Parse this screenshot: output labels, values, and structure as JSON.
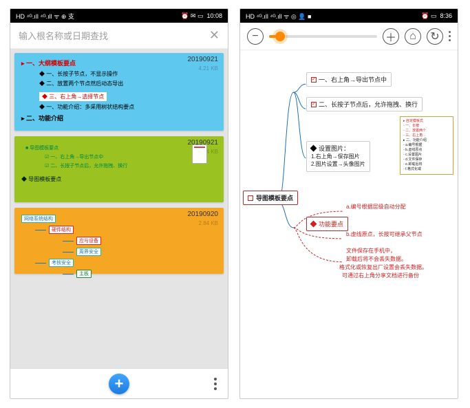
{
  "phoneL": {
    "statusbar": {
      "left": "HD ⁴ᴳ.ıll ⁴ᴳ.ıll ᯤ ⊕ 支",
      "right_icons": "⏰ ✉ ▭",
      "time": "10:08"
    },
    "search": {
      "placeholder": "输入根名称或日期查找",
      "close": "✕"
    },
    "cards": [
      {
        "bg": "#5fc8ee",
        "date": "20190921",
        "size": "4.21 KB",
        "title": "▸ 一、大纲模板要点",
        "items": [
          "◆ 一、长按子节点，不显示操作",
          "◆ 二、放置两个节点然后动态导出",
          "◆ 三、右上角→选择节点",
          "◆ 一、功能介绍：多采用树状结构要点"
        ],
        "sub": "▸ 二、功能介绍"
      },
      {
        "bg": "#9ac321",
        "date": "20190921",
        "size": "3.24 KB",
        "root": "■ 导图模板要点",
        "lines": [
          "☑ 一、右上角→导出节点中",
          "☑ 二、长按子节点后，允许拖拽、换行"
        ],
        "foot": "◆ 导图模板要点"
      },
      {
        "bg": "#f5a623",
        "date": "20190920",
        "size": "2.84 KB",
        "root": "网络系统结构",
        "nodes": [
          "硬件结构",
          "应与设备",
          "周界安全",
          "考核安全",
          "主板"
        ]
      }
    ],
    "fab": "+"
  },
  "phoneR": {
    "statusbar": {
      "left": "HD ⁴ᴳ.ıll ⁴ᴳ.ıll ᯤ ◎ 👤 ■",
      "right_icons": "⏰ ▭",
      "time": "8:36"
    },
    "toolbar": {
      "minus": "−",
      "plus": "＋",
      "home": "⌂",
      "share": "↻"
    },
    "mindmap": {
      "root": "导图模板要点",
      "n1": "一、右上角→导出节点中",
      "n2": "二、长按子节点后，允许拖拽、换行",
      "pic_title": "设置图片：",
      "pic_l1": "1.右上角→保存图片",
      "pic_l2": "2.图片设置→头像图片",
      "func": "功能要点",
      "a_line": "a.编号根据层级自动分配",
      "b_line": "b.虚线原点，长按可继承父节点",
      "note1": "文件保存在手机中，",
      "note2": "卸载后将不会丢失数据。",
      "note3": "格式化或恢复出厂设置会丢失数据。",
      "note4": "可通过右上角分享文档进行备份",
      "detail": {
        "t1": "▸ 自定模板式",
        "t1a": "◦ 一、长按",
        "t1b": "◦ 二、放置两个",
        "t1c": "◦ 三、右上角→",
        "t2": "▸ 二、功能介绍",
        "t2a": "◦ a.编号根据",
        "t2b": "◦ b.虚线原点",
        "t2c": "◦ c.设置图片",
        "t2d": "◦ d.文件保存",
        "t2e": "◦ e.卸载后将",
        "t2f": "◦ f.格式化或"
      }
    }
  }
}
